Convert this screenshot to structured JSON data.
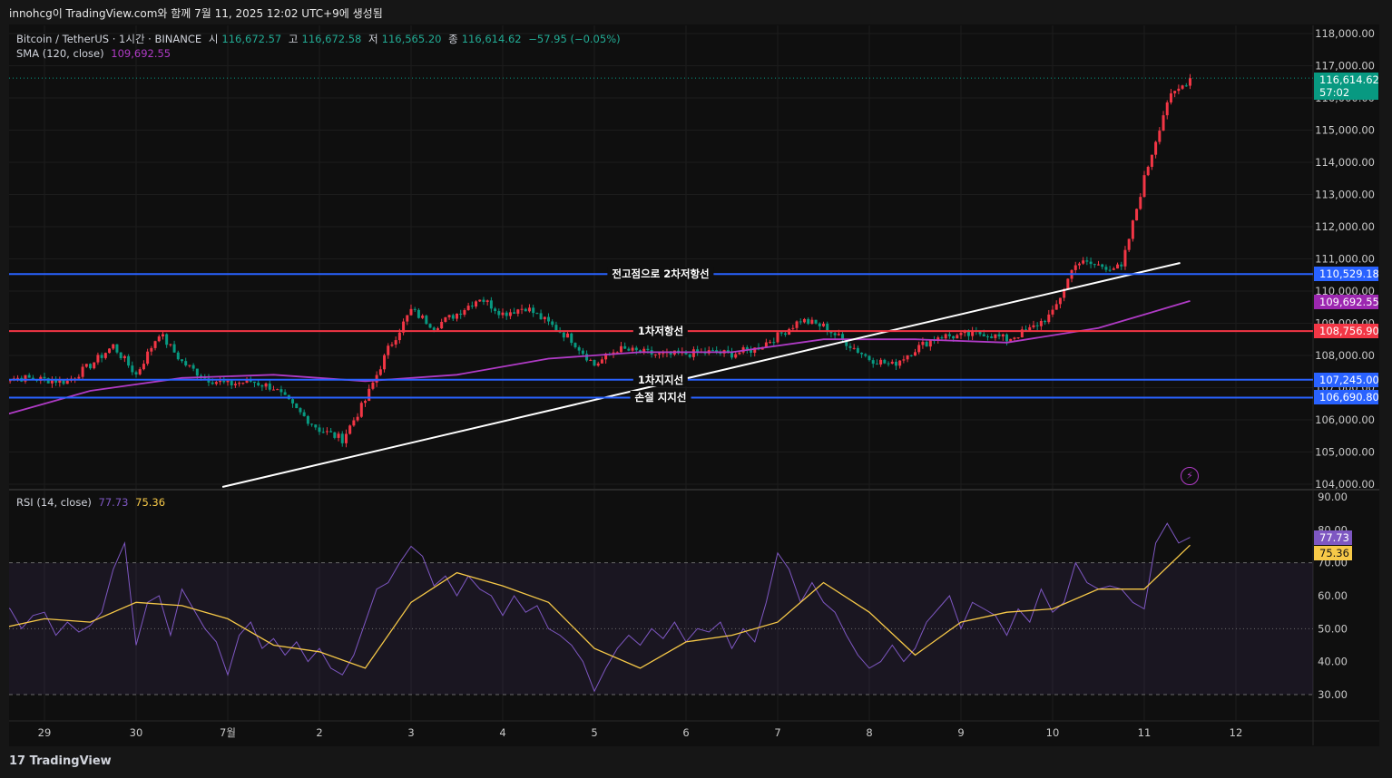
{
  "header": {
    "caption": "innohcg이 TradingView.com와 함께 7월 11, 2025 12:02 UTC+9에 생성됨"
  },
  "legend": {
    "symbol": "Bitcoin / TetherUS · 1시간 · BINANCE",
    "o_label": "시",
    "o": "116,672.57",
    "h_label": "고",
    "h": "116,672.58",
    "l_label": "저",
    "l": "116,565.20",
    "c_label": "종",
    "c": "116,614.62",
    "change": "−57.95 (−0.05%)",
    "sma_label": "SMA (120, close)",
    "sma_value": "109,692.55",
    "rsi_label": "RSI (14, close)",
    "rsi_value": "77.73",
    "rsi_ma_value": "75.36"
  },
  "badges": {
    "last_price": "116,614.62",
    "countdown": "57:02",
    "sma": "109,692.55",
    "rsi": "77.73",
    "rsi_ma": "75.36"
  },
  "levels": [
    {
      "label": "전고점으로 2차저항선",
      "price": 110529.18,
      "price_text": "110,529.18",
      "color": "#2962ff"
    },
    {
      "label": "1차저항선",
      "price": 108756.9,
      "price_text": "108,756.90",
      "color": "#f23645"
    },
    {
      "label": "1차지지선",
      "price": 107245.0,
      "price_text": "107,245.00",
      "color": "#2962ff"
    },
    {
      "label": "손절 지지선",
      "price": 106690.8,
      "price_text": "106,690.80",
      "color": "#2962ff"
    }
  ],
  "footer": {
    "brand": "TradingView"
  },
  "colors": {
    "up": "#f23645",
    "down": "#089981",
    "sma": "#b03bc6",
    "rsi": "#7e57c2",
    "rsi_ma": "#f7c948",
    "bg": "#0f0f0f",
    "grid": "#1c1c1c"
  },
  "chart_data": {
    "type": "candlestick",
    "x_unit": "hours since Jun 29 00:00 (UTC+9)",
    "price_axis": {
      "range": [
        104000,
        118000
      ],
      "ticks": [
        "104,000.00",
        "105,000.00",
        "106,000.00",
        "107,000.00",
        "108,000.00",
        "109,000.00",
        "110,000.00",
        "111,000.00",
        "112,000.00",
        "113,000.00",
        "114,000.00",
        "115,000.00",
        "116,000.00",
        "117,000.00",
        "118,000.00"
      ]
    },
    "time_axis": {
      "ticks": [
        "29",
        "30",
        "7월",
        "2",
        "3",
        "4",
        "5",
        "6",
        "7",
        "8",
        "9",
        "10",
        "11",
        "12"
      ]
    },
    "close_series": {
      "start": -12,
      "step": 6,
      "values": [
        107300,
        107300,
        107250,
        107200,
        107700,
        108300,
        107400,
        108700,
        107800,
        107300,
        107100,
        107200,
        107000,
        106300,
        105700,
        105400,
        106600,
        108200,
        109400,
        108900,
        109300,
        109800,
        109300,
        109500,
        109000,
        108500,
        107700,
        108200,
        108100,
        108000,
        108050,
        108100,
        108050,
        108200,
        108600,
        109100,
        108900,
        108400,
        107900,
        107700,
        108200,
        108600,
        108600,
        108700,
        108500,
        108800,
        109300,
        110900,
        110800,
        110700,
        113500,
        115900,
        116614.62
      ]
    },
    "sma_series": {
      "start": -12,
      "step": 24,
      "values": [
        106100,
        106900,
        107300,
        107400,
        107200,
        107400,
        107900,
        108100,
        108100,
        108500,
        108500,
        108400,
        108850,
        109692.55
      ]
    },
    "trendline": {
      "from": {
        "t": 46.6,
        "price": 103915
      },
      "to": {
        "t": 297.4,
        "price": 110873
      }
    },
    "rsi": {
      "range": [
        25,
        92
      ],
      "ticks": [
        "30.00",
        "40.00",
        "50.00",
        "60.00",
        "70.00",
        "80.00",
        "90.00"
      ],
      "bands": [
        30,
        50,
        70
      ],
      "series": {
        "start": -12,
        "step": 3,
        "values": [
          58,
          56,
          50,
          54,
          55,
          48,
          52,
          49,
          51,
          55,
          68,
          76,
          45,
          58,
          60,
          48,
          62,
          56,
          50,
          46,
          36,
          48,
          52,
          44,
          47,
          42,
          46,
          40,
          44,
          38,
          36,
          42,
          52,
          62,
          64,
          70,
          75,
          72,
          63,
          66,
          60,
          66,
          62,
          60,
          54,
          60,
          55,
          57,
          50,
          48,
          45,
          40,
          31,
          38,
          44,
          48,
          45,
          50,
          47,
          52,
          46,
          50,
          49,
          52,
          44,
          50,
          46,
          58,
          73,
          68,
          58,
          64,
          58,
          55,
          48,
          42,
          38,
          40,
          45,
          40,
          44,
          52,
          56,
          60,
          50,
          58,
          56,
          54,
          48,
          56,
          52,
          62,
          55,
          58,
          70,
          64,
          62,
          63,
          62,
          58,
          56,
          76,
          82,
          76,
          77.73
        ]
      },
      "ma_series": {
        "start": -12,
        "step": 12,
        "values": [
          50,
          53,
          52,
          58,
          57,
          53,
          45,
          43,
          38,
          58,
          67,
          63,
          58,
          44,
          38,
          46,
          48,
          52,
          64,
          55,
          42,
          52,
          55,
          56,
          62,
          62,
          75.36
        ]
      }
    }
  }
}
